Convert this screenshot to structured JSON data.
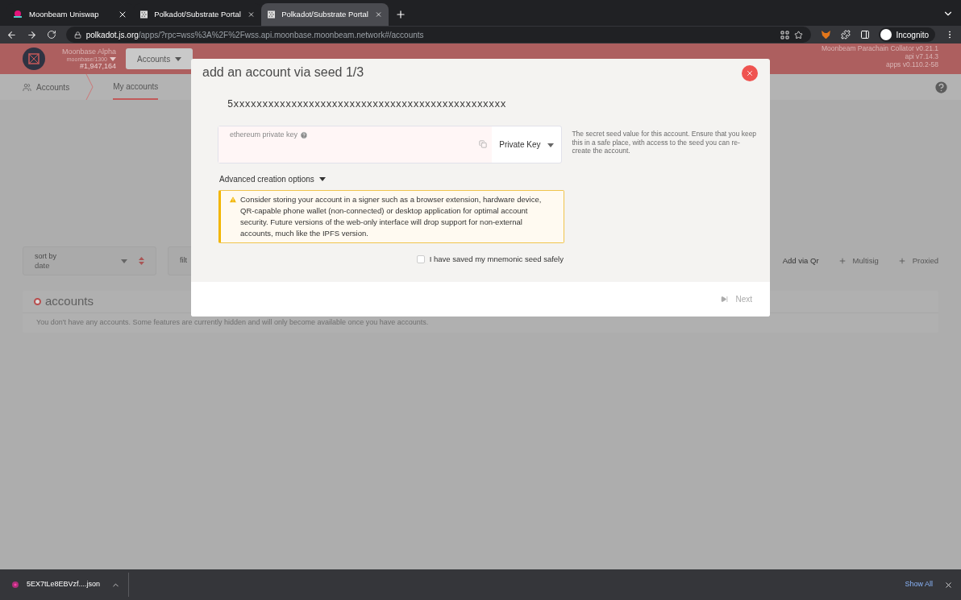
{
  "browser": {
    "tabs": [
      {
        "title": "Moonbeam Uniswap",
        "selected": false
      },
      {
        "title": "Polkadot/Substrate Portal",
        "selected": false
      },
      {
        "title": "Polkadot/Substrate Portal",
        "selected": true
      }
    ],
    "url_host": "polkadot.js.org",
    "url_path": "/apps/?rpc=wss%3A%2F%2Fwss.api.moonbase.moonbeam.network#/accounts",
    "profile": "Incognito"
  },
  "app_header": {
    "chain": "Moonbase Alpha",
    "runtime": "moonbase/1300",
    "block": "#1,947,164",
    "nav": [
      {
        "label": "Accounts",
        "selected": true
      }
    ],
    "versions": [
      "Moonbeam Parachain Collator v0.21.1",
      "api v7.14.3",
      "apps v0.110.2-58"
    ]
  },
  "sub_nav": {
    "section": "Accounts",
    "tabs": [
      {
        "label": "My accounts",
        "selected": true
      }
    ]
  },
  "toolbar": {
    "sort_label": "sort by",
    "sort_value": "date",
    "filter_label": "filt",
    "actions": [
      {
        "label": "Add via Qr",
        "icon": false
      },
      {
        "label": "Multisig",
        "icon": true
      },
      {
        "label": "Proxied",
        "icon": true
      }
    ]
  },
  "accounts_section": {
    "title": "accounts",
    "empty_text": "You don't have any accounts. Some features are currently hidden and will only become available once you have accounts."
  },
  "modal": {
    "title": "add an account via seed 1/3",
    "address": "5xxxxxxxxxxxxxxxxxxxxxxxxxxxxxxxxxxxxxxxxxxxxxxx",
    "seed_field": {
      "label": "ethereum private key",
      "type_value": "Private Key"
    },
    "help": "The secret seed value for this account. Ensure that you keep this in a safe place, with access to the seed you can re-create the account.",
    "advanced": {
      "label": "Advanced creation options",
      "expanded": false
    },
    "warning": "Consider storing your account in a signer such as a browser extension, hardware device, QR-capable phone wallet (non-connected) or desktop application for optimal account security. Future versions of the web-only interface will drop support for non-external accounts, much like the IPFS version.",
    "confirm": {
      "label": "I have saved my mnemonic seed safely",
      "checked": false
    },
    "next": {
      "label": "Next",
      "disabled": true
    }
  },
  "downloads": {
    "file": "5EX7tLe8EBVzf....json",
    "show_all": "Show All"
  }
}
